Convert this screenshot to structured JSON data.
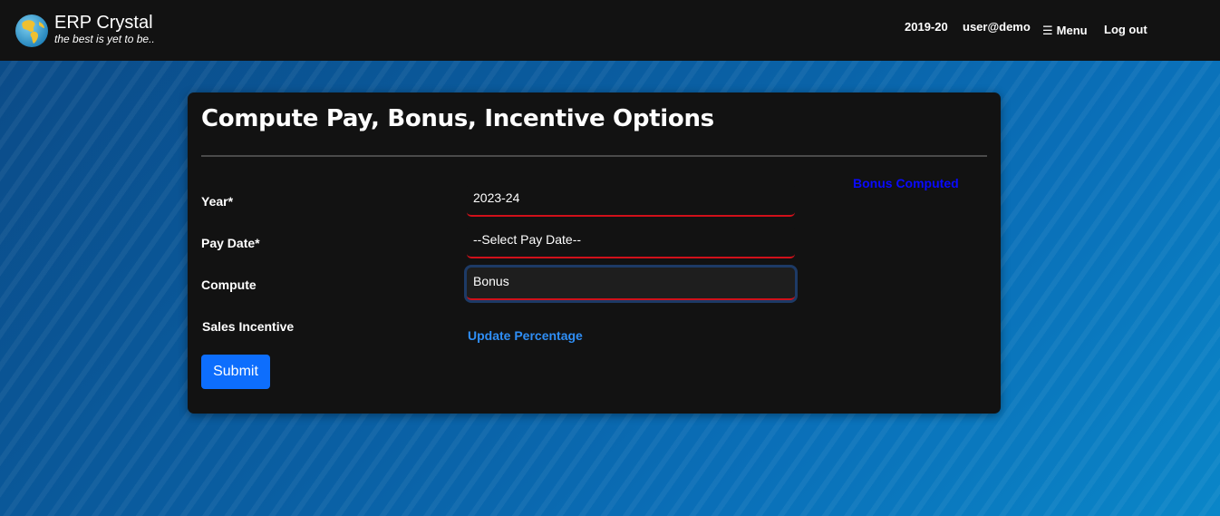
{
  "header": {
    "app_name": "ERP Crystal",
    "tagline": "the best is yet to be..",
    "logo_icon": "globe-icon",
    "fiscal_year": "2019-20",
    "user": "user@demo",
    "menu_label": "Menu",
    "menu_icon": "hamburger-icon",
    "logout_label": "Log out"
  },
  "form": {
    "title": "Compute Pay, Bonus, Incentive Options",
    "status_text": "Bonus Computed",
    "status_color": "#0a0aff",
    "fields": {
      "year_label": "Year*",
      "year_value": "2023-24",
      "pay_date_label": "Pay Date*",
      "pay_date_value": "--Select Pay Date--",
      "compute_label": "Compute",
      "compute_value": "Bonus",
      "sales_incentive_label": "Sales Incentive",
      "update_link": "Update Percentage"
    },
    "submit_label": "Submit"
  },
  "colors": {
    "topbar": "#121212",
    "card": "#121212",
    "accent": "#0d6efd",
    "field_underline": "#d0101a",
    "link": "#2f8ef5"
  }
}
